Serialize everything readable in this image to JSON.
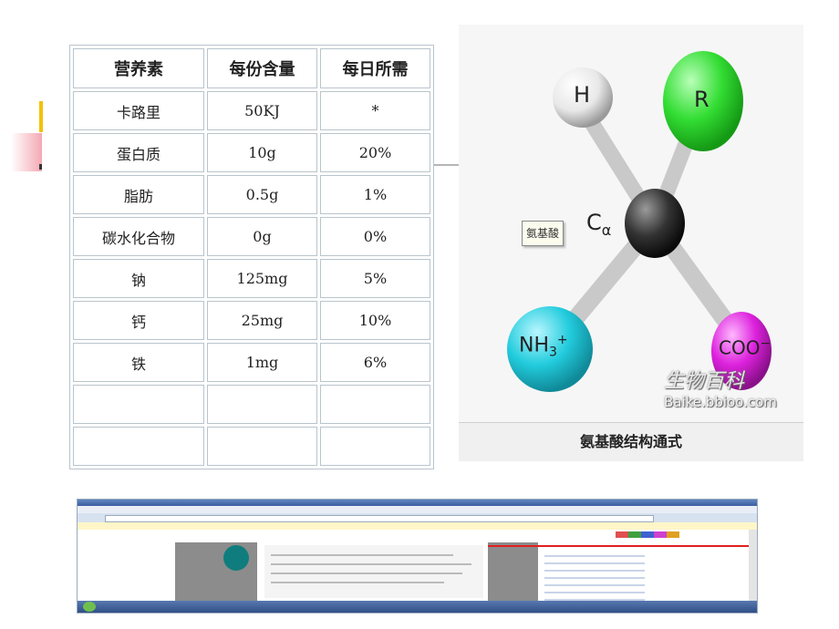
{
  "table": {
    "headers": [
      "营养素",
      "每份含量",
      "每日所需"
    ],
    "rows": [
      [
        "卡路里",
        "50KJ",
        "*"
      ],
      [
        "蛋白质",
        "10g",
        "20%"
      ],
      [
        "脂肪",
        "0.5g",
        "1%"
      ],
      [
        "碳水化合物",
        "0g",
        "0%"
      ],
      [
        "钠",
        "125mg",
        "5%"
      ],
      [
        "钙",
        "25mg",
        "10%"
      ],
      [
        "铁",
        "1mg",
        "6%"
      ],
      [
        "",
        "",
        ""
      ],
      [
        "",
        "",
        ""
      ]
    ]
  },
  "molecule": {
    "tag": "氨基酸",
    "atoms": {
      "h": "H",
      "r": "R",
      "c": "C",
      "c_sub": "α",
      "n": "NH",
      "n_sub": "3",
      "n_sup": "+",
      "coo": "COO",
      "coo_sup": "−"
    },
    "colors": {
      "h": "#e8e8e8",
      "r": "#33dd33",
      "c": "#333333",
      "n": "#22ccdd",
      "coo": "#dd22dd"
    },
    "caption": "氨基酸结构通式",
    "watermark": "生物百科",
    "watermark_url": "Baike.bbioo.com"
  },
  "browser_screenshot": {
    "description_visible": "嵌入的网页截图（文字模糊不可辨）"
  }
}
